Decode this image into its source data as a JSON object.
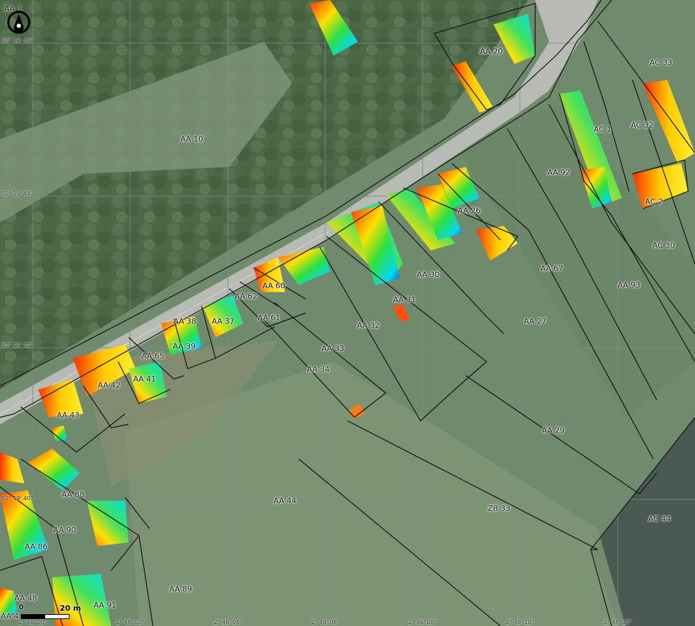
{
  "map": {
    "corner_label": "AA 1",
    "parcels": [
      {
        "id": "AA 20"
      },
      {
        "id": "AC 33"
      },
      {
        "id": "AC 1"
      },
      {
        "id": "AC 32"
      },
      {
        "id": "AA 10"
      },
      {
        "id": "AA 92"
      },
      {
        "id": "AC 2"
      },
      {
        "id": "AA 26"
      },
      {
        "id": "AC 30"
      },
      {
        "id": "AA 30"
      },
      {
        "id": "AA 67"
      },
      {
        "id": "AA 93"
      },
      {
        "id": "AA 60"
      },
      {
        "id": "AA 62"
      },
      {
        "id": "AA 31"
      },
      {
        "id": "AA 38"
      },
      {
        "id": "AA 37"
      },
      {
        "id": "AA 61"
      },
      {
        "id": "AA 27"
      },
      {
        "id": "AA 32"
      },
      {
        "id": "AA 39"
      },
      {
        "id": "AA 33"
      },
      {
        "id": "AA 65"
      },
      {
        "id": "AA 34"
      },
      {
        "id": "AA 41"
      },
      {
        "id": "AA 42"
      },
      {
        "id": "AA 43"
      },
      {
        "id": "AA 29"
      },
      {
        "id": "AA 88"
      },
      {
        "id": "AA 44"
      },
      {
        "id": "ZB 33"
      },
      {
        "id": "AC 44"
      },
      {
        "id": "AA 90"
      },
      {
        "id": "AA 86"
      },
      {
        "id": "AA 89"
      },
      {
        "id": "AA 48"
      },
      {
        "id": "AA 91"
      },
      {
        "id": "AA 4"
      }
    ],
    "latitude_ticks": [
      "50° 19' 46\"",
      "50° 19' 44\"",
      "50° 19' 42\"",
      "50° 19' 40\""
    ],
    "longitude_ticks": [
      "2° 46' 00\"",
      "2° 46' 02\"",
      "2° 46' 04\"",
      "2° 46' 06\"",
      "2° 46' 08\"",
      "2° 46' 10\"",
      "2° 46' 12\""
    ],
    "scale_bar": {
      "zero": "0",
      "distance": "20 m"
    },
    "colors": {
      "forest": "#4f6a48",
      "field": "#6f8a6c",
      "road": "#b9bcb4",
      "parcel_line": "#111111",
      "grid_line": "#7a8a80"
    },
    "north_arrow_icon": "compass-icon"
  }
}
